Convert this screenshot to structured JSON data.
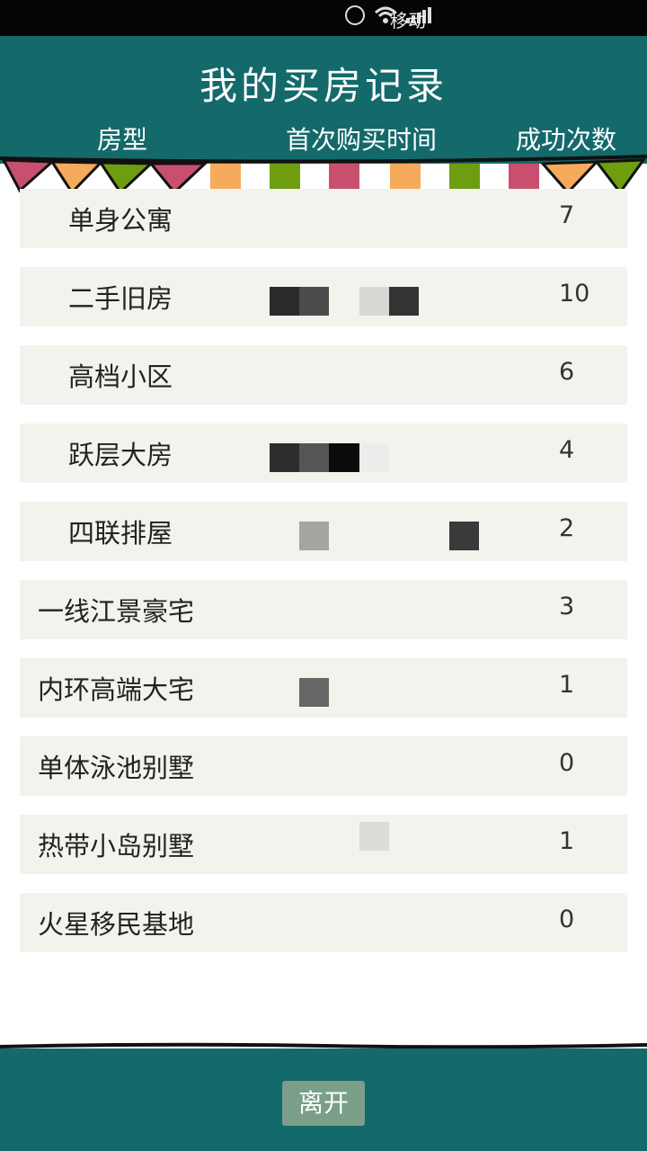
{
  "status_bar": {
    "carrier": "移动",
    "icons": [
      "alarm-icon",
      "wifi-icon",
      "signal-icon"
    ]
  },
  "header": {
    "title": "我的买房记录",
    "columns": {
      "type": "房型",
      "first_time": "首次购买时间",
      "count": "成功次数"
    }
  },
  "records": [
    {
      "name": "单身公寓",
      "count": "7"
    },
    {
      "name": "二手旧房",
      "count": "10"
    },
    {
      "name": "高档小区",
      "count": "6"
    },
    {
      "name": "跃层大房",
      "count": "4"
    },
    {
      "name": "四联排屋",
      "count": "2"
    },
    {
      "name": "一线江景豪宅",
      "count": "3"
    },
    {
      "name": "内环高端大宅",
      "count": "1"
    },
    {
      "name": "单体泳池别墅",
      "count": "0"
    },
    {
      "name": "热带小岛别墅",
      "count": "1"
    },
    {
      "name": "火星移民基地",
      "count": "0"
    }
  ],
  "footer": {
    "leave_label": "离开"
  },
  "colors": {
    "header_bg": "#14696b",
    "row_bg": "#f1f3ec",
    "button_bg": "#7a9e88"
  }
}
